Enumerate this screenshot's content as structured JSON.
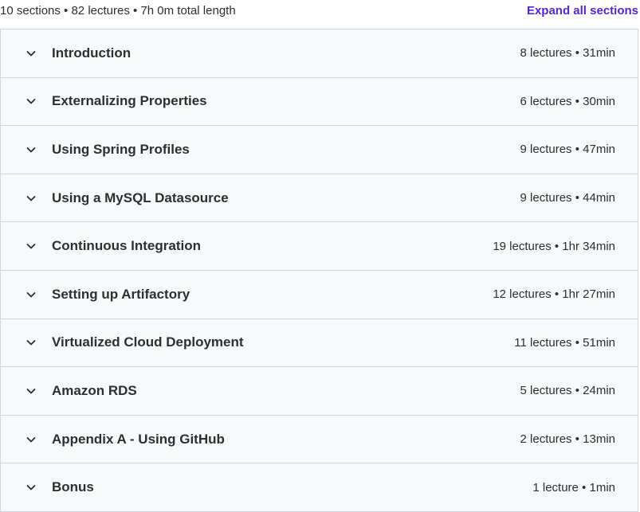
{
  "summary": {
    "text": "10 sections • 82 lectures • 7h 0m total length",
    "expand_label": "Expand all sections"
  },
  "colors": {
    "accent": "#5624d0",
    "row_bg": "#f7f9fa",
    "border": "#d1d7dc",
    "text": "#2d2f31"
  },
  "sections": [
    {
      "title": "Introduction",
      "meta": "8 lectures • 31min",
      "icon": "chevron-down-icon"
    },
    {
      "title": "Externalizing Properties",
      "meta": "6 lectures • 30min",
      "icon": "chevron-down-icon"
    },
    {
      "title": "Using Spring Profiles",
      "meta": "9 lectures • 47min",
      "icon": "chevron-down-icon"
    },
    {
      "title": "Using a MySQL Datasource",
      "meta": "9 lectures • 44min",
      "icon": "chevron-down-icon"
    },
    {
      "title": "Continuous Integration",
      "meta": "19 lectures • 1hr 34min",
      "icon": "chevron-down-icon"
    },
    {
      "title": "Setting up Artifactory",
      "meta": "12 lectures • 1hr 27min",
      "icon": "chevron-down-icon"
    },
    {
      "title": "Virtualized Cloud Deployment",
      "meta": "11 lectures • 51min",
      "icon": "chevron-down-icon"
    },
    {
      "title": "Amazon RDS",
      "meta": "5 lectures • 24min",
      "icon": "chevron-down-icon"
    },
    {
      "title": "Appendix A - Using GitHub",
      "meta": "2 lectures • 13min",
      "icon": "chevron-down-icon"
    },
    {
      "title": "Bonus",
      "meta": "1 lecture • 1min",
      "icon": "chevron-down-icon"
    }
  ]
}
